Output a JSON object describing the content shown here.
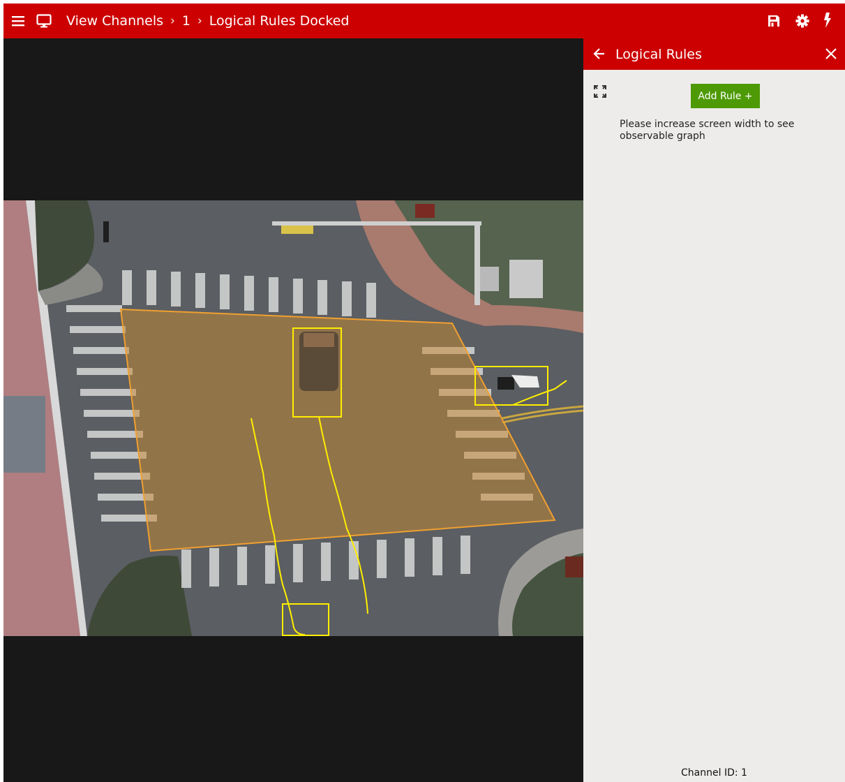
{
  "header": {
    "breadcrumb": [
      "View Channels",
      "1",
      "Logical Rules Docked"
    ],
    "separator": "›",
    "icons": [
      "hamburger-menu-icon",
      "monitor-icon",
      "save-icon",
      "gear-icon",
      "bolt-icon"
    ]
  },
  "panel": {
    "title": "Logical Rules",
    "add_rule_label": "Add Rule +",
    "message": "Please increase screen width to see observable graph",
    "channel_id_label": "Channel ID: 1",
    "icons": [
      "back-arrow-icon",
      "close-icon",
      "expand-icon"
    ]
  },
  "colors": {
    "brand_red": "#cc0000",
    "add_rule_green": "#4e9a06",
    "zone_orange": "#f0a030",
    "detection_yellow": "#ffee00",
    "panel_bg": "#edecea"
  }
}
